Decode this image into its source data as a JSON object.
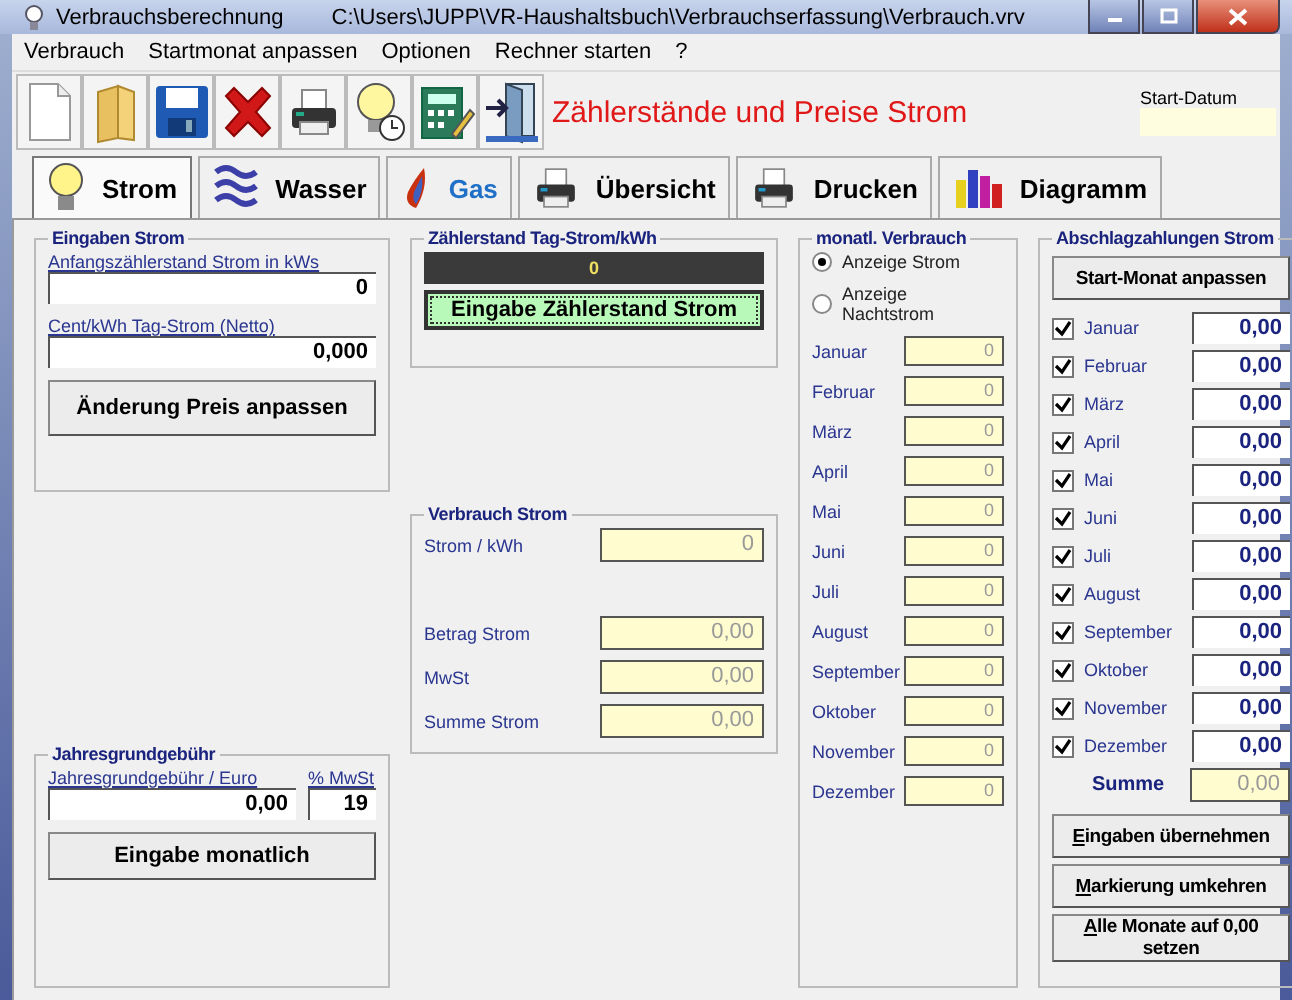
{
  "window": {
    "title": "Verbrauchsberechnung",
    "path": "C:\\Users\\JUPP\\VR-Haushaltsbuch\\Verbrauchserfassung\\Verbrauch.vrv"
  },
  "menu": [
    "Verbrauch",
    "Startmonat anpassen",
    "Optionen",
    "Rechner starten",
    "?"
  ],
  "toolbar": {
    "heading": "Zählerstände und Preise Strom",
    "start_date_label": "Start-Datum"
  },
  "tabs": [
    {
      "label": "Strom",
      "selected": true,
      "highlighted": false,
      "kind": "bulb"
    },
    {
      "label": "Wasser",
      "selected": false,
      "highlighted": false,
      "kind": "waves"
    },
    {
      "label": "Gas",
      "selected": false,
      "highlighted": true,
      "kind": "flame"
    },
    {
      "label": "Übersicht",
      "selected": false,
      "highlighted": false,
      "kind": "printer"
    },
    {
      "label": "Drucken",
      "selected": false,
      "highlighted": false,
      "kind": "printer"
    },
    {
      "label": "Diagramm",
      "selected": false,
      "highlighted": false,
      "kind": "bars"
    }
  ],
  "eingaben": {
    "title": "Eingaben  Strom",
    "fields": [
      {
        "label": "Anfangszählerstand Strom in kWs",
        "value": "0"
      },
      {
        "label": "Cent/kWh Tag-Strom (Netto)",
        "value": "0,000"
      }
    ],
    "button": "Änderung Preis anpassen"
  },
  "jahresgrund": {
    "title": "Jahresgrundgebühr",
    "fee_label": "Jahresgrundgebühr / Euro",
    "fee_value": "0,00",
    "vat_label": "% MwSt",
    "vat_value": "19",
    "button": "Eingabe monatlich"
  },
  "zaehlerstand": {
    "title": "Zählerstand Tag-Strom/kWh",
    "display": "0",
    "button": "Eingabe Zählerstand Strom"
  },
  "verbrauch": {
    "title": "Verbrauch Strom",
    "usage": {
      "label": "Strom / kWh",
      "value": "0"
    },
    "amounts": [
      {
        "label": "Betrag Strom",
        "value": "0,00"
      },
      {
        "label": "MwSt",
        "value": "0,00"
      },
      {
        "label": "Summe Strom",
        "value": "0,00"
      }
    ]
  },
  "monthly": {
    "title": "monatl. Verbrauch",
    "options": [
      {
        "label": "Anzeige Strom",
        "selected": true
      },
      {
        "label": "Anzeige Nachtstrom",
        "selected": false
      }
    ],
    "months": [
      {
        "label": "Januar",
        "value": "0"
      },
      {
        "label": "Februar",
        "value": "0"
      },
      {
        "label": "März",
        "value": "0"
      },
      {
        "label": "April",
        "value": "0"
      },
      {
        "label": "Mai",
        "value": "0"
      },
      {
        "label": "Juni",
        "value": "0"
      },
      {
        "label": "Juli",
        "value": "0"
      },
      {
        "label": "August",
        "value": "0"
      },
      {
        "label": "September",
        "value": "0"
      },
      {
        "label": "Oktober",
        "value": "0"
      },
      {
        "label": "November",
        "value": "0"
      },
      {
        "label": "Dezember",
        "value": "0"
      }
    ]
  },
  "payments": {
    "title": "Abschlagzahlungen Strom",
    "start_button": "Start-Monat anpassen",
    "months": [
      {
        "label": "Januar",
        "checked": true,
        "value": "0,00"
      },
      {
        "label": "Februar",
        "checked": true,
        "value": "0,00"
      },
      {
        "label": "März",
        "checked": true,
        "value": "0,00"
      },
      {
        "label": "April",
        "checked": true,
        "value": "0,00"
      },
      {
        "label": "Mai",
        "checked": true,
        "value": "0,00"
      },
      {
        "label": "Juni",
        "checked": true,
        "value": "0,00"
      },
      {
        "label": "Juli",
        "checked": true,
        "value": "0,00"
      },
      {
        "label": "August",
        "checked": true,
        "value": "0,00"
      },
      {
        "label": "September",
        "checked": true,
        "value": "0,00"
      },
      {
        "label": "Oktober",
        "checked": true,
        "value": "0,00"
      },
      {
        "label": "November",
        "checked": true,
        "value": "0,00"
      },
      {
        "label": "Dezember",
        "checked": true,
        "value": "0,00"
      }
    ],
    "sum_label": "Summe",
    "sum_value": "0,00",
    "buttons": [
      {
        "label": "Eingaben übernehmen",
        "underline_first": true
      },
      {
        "label": "Markierung umkehren",
        "underline_first": true
      },
      {
        "label": "Alle Monate auf 0,00 setzen",
        "underline_first": true
      }
    ]
  }
}
